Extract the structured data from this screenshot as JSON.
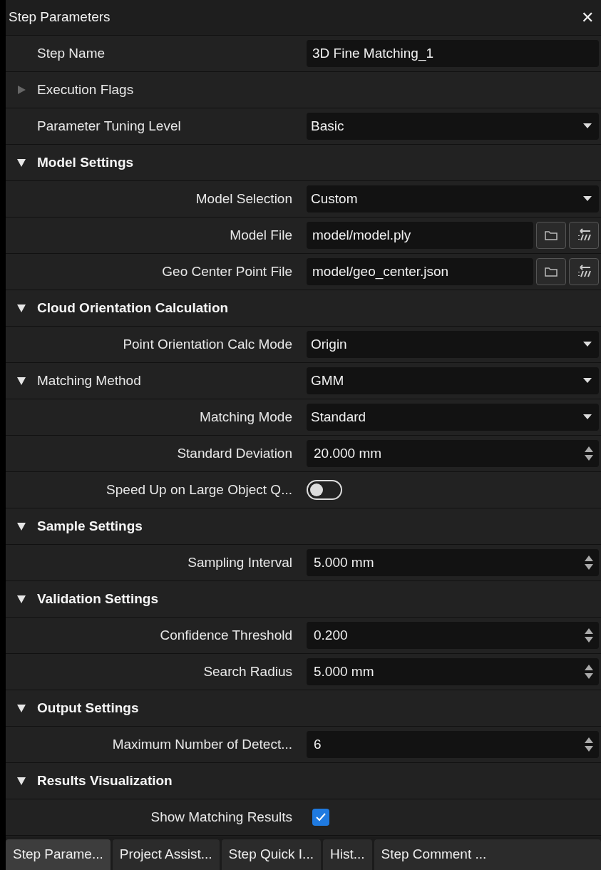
{
  "window": {
    "title": "Step Parameters",
    "close": "✕"
  },
  "params": [
    {
      "kind": "text",
      "label": "Step Name",
      "value": "3D Fine Matching_1"
    },
    {
      "kind": "group",
      "label": "Execution Flags",
      "expanded": false
    },
    {
      "kind": "select",
      "label": "Parameter Tuning Level",
      "value": "Basic"
    },
    {
      "kind": "section",
      "label": "Model Settings",
      "expanded": true,
      "children": [
        {
          "kind": "select",
          "label": "Model Selection",
          "value": "Custom"
        },
        {
          "kind": "file",
          "label": "Model File",
          "value": "model/model.ply"
        },
        {
          "kind": "file",
          "label": "Geo Center Point File",
          "value": "model/geo_center.json"
        }
      ]
    },
    {
      "kind": "section",
      "label": "Cloud Orientation Calculation",
      "expanded": true,
      "children": [
        {
          "kind": "select",
          "label": "Point Orientation Calc Mode",
          "value": "Origin"
        }
      ]
    },
    {
      "kind": "select",
      "label": "Matching Method",
      "value": "GMM",
      "expanded": true,
      "children": [
        {
          "kind": "select",
          "label": "Matching Mode",
          "value": "Standard"
        },
        {
          "kind": "spin",
          "label": "Standard Deviation",
          "value": "20.000 mm"
        },
        {
          "kind": "toggle",
          "label": "Speed Up on Large Object Q...",
          "on": false
        }
      ]
    },
    {
      "kind": "section",
      "label": "Sample Settings",
      "expanded": true,
      "children": [
        {
          "kind": "spin",
          "label": "Sampling Interval",
          "value": "5.000 mm"
        }
      ]
    },
    {
      "kind": "section",
      "label": "Validation Settings",
      "expanded": true,
      "children": [
        {
          "kind": "spin",
          "label": "Confidence Threshold",
          "value": "0.200"
        },
        {
          "kind": "spin",
          "label": "Search Radius",
          "value": "5.000 mm"
        }
      ]
    },
    {
      "kind": "section",
      "label": "Output Settings",
      "expanded": true,
      "children": [
        {
          "kind": "spin",
          "label": "Maximum Number of Detect...",
          "value": "6"
        }
      ]
    },
    {
      "kind": "section",
      "label": "Results Visualization",
      "expanded": true,
      "children": [
        {
          "kind": "checkbox",
          "label": "Show Matching Results",
          "checked": true
        }
      ]
    }
  ],
  "tabs": [
    {
      "label": "Step Parame...",
      "selected": true
    },
    {
      "label": "Project Assist...",
      "selected": false
    },
    {
      "label": "Step Quick I...",
      "selected": false
    },
    {
      "label": "Hist...",
      "selected": false
    },
    {
      "label": "Step Comment ...",
      "selected": false
    }
  ]
}
